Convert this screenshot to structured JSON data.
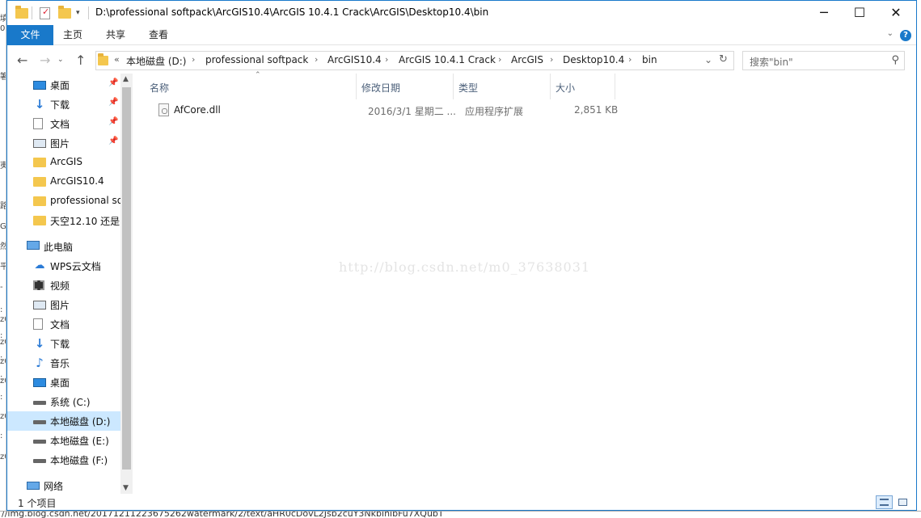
{
  "window": {
    "title": "D:\\professional softpack\\ArcGIS10.4\\ArcGIS 10.4.1 Crack\\ArcGIS\\Desktop10.4\\bin"
  },
  "ribbon": {
    "tabs": [
      "文件",
      "主页",
      "共享",
      "查看"
    ],
    "help": "?"
  },
  "address": {
    "overflow": "«",
    "crumbs": [
      "本地磁盘 (D:)",
      "professional softpack",
      "ArcGIS10.4",
      "ArcGIS 10.4.1 Crack",
      "ArcGIS",
      "Desktop10.4",
      "bin"
    ]
  },
  "search": {
    "placeholder": "搜索\"bin\""
  },
  "nav": {
    "items": [
      {
        "label": "桌面",
        "icon": "desktop-icon",
        "pinned": true
      },
      {
        "label": "下载",
        "icon": "download-icon",
        "pinned": true
      },
      {
        "label": "文档",
        "icon": "document-icon",
        "pinned": true
      },
      {
        "label": "图片",
        "icon": "pictures-icon",
        "pinned": true
      },
      {
        "label": "ArcGIS",
        "icon": "folder-icon"
      },
      {
        "label": "ArcGIS10.4",
        "icon": "folder-icon"
      },
      {
        "label": "professional so",
        "icon": "folder-icon"
      },
      {
        "label": "天空12.10 还是",
        "icon": "folder-icon"
      },
      {
        "label": "此电脑",
        "icon": "this-pc-icon"
      },
      {
        "label": "WPS云文档",
        "icon": "cloud-icon"
      },
      {
        "label": "视频",
        "icon": "video-icon"
      },
      {
        "label": "图片",
        "icon": "pictures-icon"
      },
      {
        "label": "文档",
        "icon": "document-icon"
      },
      {
        "label": "下载",
        "icon": "download-icon"
      },
      {
        "label": "音乐",
        "icon": "music-icon"
      },
      {
        "label": "桌面",
        "icon": "desktop-icon"
      },
      {
        "label": "系统 (C:)",
        "icon": "drive-icon"
      },
      {
        "label": "本地磁盘 (D:)",
        "icon": "drive-icon",
        "selected": true
      },
      {
        "label": "本地磁盘 (E:)",
        "icon": "drive-icon"
      },
      {
        "label": "本地磁盘 (F:)",
        "icon": "drive-icon"
      },
      {
        "label": "网络",
        "icon": "network-icon"
      }
    ]
  },
  "columns": [
    "名称",
    "修改日期",
    "类型",
    "大小"
  ],
  "files": [
    {
      "name": "AfCore.dll",
      "modified": "2016/3/1 星期二 ...",
      "type": "应用程序扩展",
      "size": "2,851 KB"
    }
  ],
  "watermark": "http://blog.csdn.net/m0_37638031",
  "status": {
    "count": "1 个项目"
  },
  "background": {
    "bottom_text": "//img.blog.csdn.net/20171211223675262watermark/2/text/aHR0cDovL2Jsb2cuY3NkbihibFu7XQubT",
    "left_chars": [
      "填",
      "0",
      "箸",
      "夷",
      "路",
      "G",
      "然",
      "平",
      "-",
      ":",
      "z0",
      ":",
      "z0",
      ":",
      "z0",
      ":",
      "z0",
      ":",
      "z0",
      ":",
      "z0"
    ]
  },
  "colors": {
    "accent": "#1979ca",
    "selection": "#cce8ff"
  }
}
